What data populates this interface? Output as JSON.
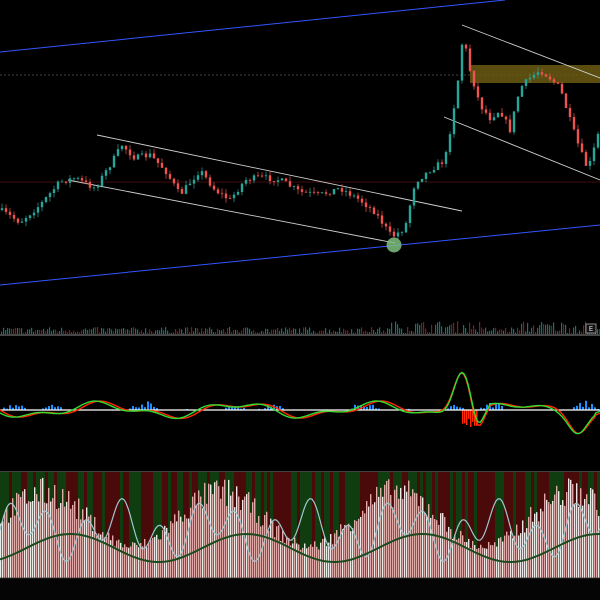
{
  "colors": {
    "background": "#000000",
    "candle_up": "#26a69a",
    "candle_down": "#ef5350",
    "trendline_blue": "#3355ff",
    "channel_white": "#cfcfcf",
    "zone_fill": "#6b5a12",
    "osc_red": "#ff2a00",
    "osc_green": "#33dd33",
    "osc_blue": "#1e90ff",
    "osc_white": "#ffffff",
    "hist_green": "#0f3d0f",
    "hist_red": "#4a0a0a",
    "hist_pink": "#f4b8b8",
    "hist_line": "#9fc7d2"
  },
  "chart_data": [
    {
      "type": "candlestick",
      "name": "price",
      "x_index": [
        0,
        120
      ],
      "close_path": [
        62,
        60,
        58,
        63,
        55,
        52,
        48,
        47,
        45,
        44,
        42,
        48,
        40,
        38,
        34,
        28,
        30,
        34,
        36,
        40,
        42,
        38,
        36,
        44,
        41,
        40,
        44,
        38,
        42,
        36,
        40,
        42,
        40,
        44,
        42,
        46,
        48,
        44,
        40,
        38,
        36,
        38,
        40,
        38,
        35,
        34,
        33,
        32,
        34,
        36,
        38,
        44,
        48,
        52,
        55,
        58,
        56,
        60,
        64,
        66,
        70,
        72,
        78,
        60,
        40,
        30,
        20,
        8,
        0,
        4,
        12,
        18,
        22,
        16,
        10,
        6,
        4,
        2,
        4,
        8,
        14,
        12,
        6,
        4,
        2,
        0,
        6,
        16,
        24,
        34,
        40
      ],
      "annotations": [
        "E"
      ]
    },
    {
      "type": "bar",
      "name": "volume"
    },
    {
      "type": "line",
      "name": "oscillator",
      "series": [
        {
          "color": "red"
        },
        {
          "color": "green"
        }
      ]
    },
    {
      "type": "bar",
      "name": "histogram"
    }
  ],
  "markers": {
    "volume_flag": "E"
  }
}
